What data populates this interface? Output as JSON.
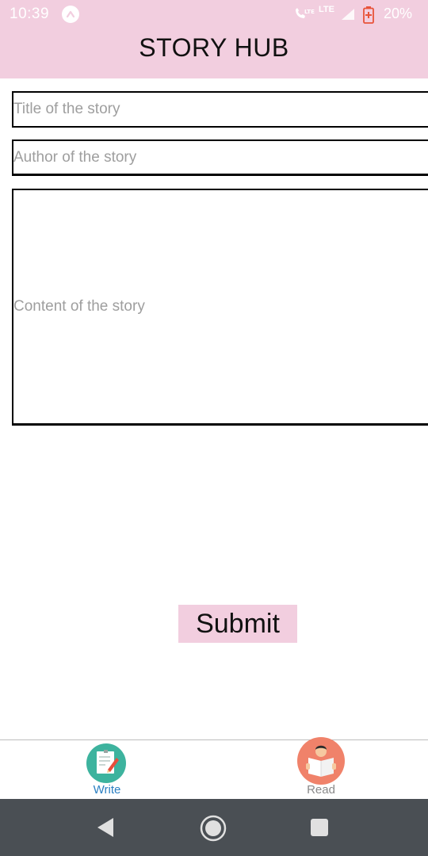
{
  "status_bar": {
    "time": "10:39",
    "network": "LTE",
    "battery": "20%"
  },
  "app": {
    "title": "STORY HUB",
    "header_color": "#f2cedf"
  },
  "form": {
    "title_placeholder": "Title of the story",
    "author_placeholder": "Author of the story",
    "content_placeholder": "Content of the story",
    "submit_label": "Submit"
  },
  "tabs": [
    {
      "label": "Write",
      "icon": "write-icon",
      "active": true
    },
    {
      "label": "Read",
      "icon": "read-icon",
      "active": false
    }
  ],
  "colors": {
    "active_tab": "#2a7fc2",
    "inactive_tab": "#8a8a8a",
    "nav_bar": "#4a4f54"
  }
}
